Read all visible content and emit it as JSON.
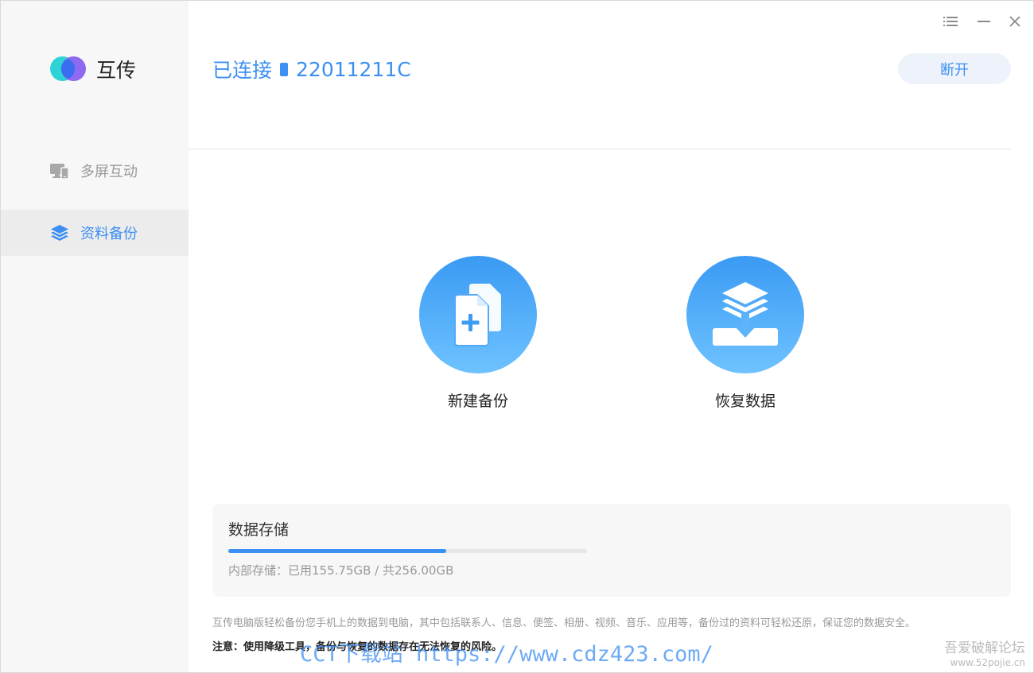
{
  "app": {
    "name": "互传"
  },
  "window_controls": {
    "menu_icon": "list-menu-icon",
    "minimize_icon": "minimize-icon",
    "close_icon": "close-icon"
  },
  "sidebar": {
    "items": [
      {
        "label": "多屏互动",
        "icon": "monitor-phone-icon",
        "active": false
      },
      {
        "label": "资料备份",
        "icon": "layers-icon",
        "active": true
      }
    ]
  },
  "header": {
    "status": "已连接",
    "device_icon": "phone-icon",
    "device_name": "22011211C",
    "disconnect_label": "断开"
  },
  "actions": [
    {
      "label": "新建备份",
      "icon": "new-backup-icon"
    },
    {
      "label": "恢复数据",
      "icon": "restore-data-icon"
    }
  ],
  "storage": {
    "title": "数据存储",
    "info": "内部存储：已用155.75GB / 共256.00GB",
    "used_fraction": 0.608
  },
  "description": "互传电脑版轻松备份您手机上的数据到电脑，其中包括联系人、信息、便签、相册、视频、音乐、应用等，备份过的资料可轻松还原，保证您的数据安全。",
  "note": "注意：使用降级工具，备份与恢复的数据存在无法恢复的风险。",
  "watermark": {
    "main": "CCT下载站 https://www.cdz423.com/",
    "right_line1": "吾爱破解论坛",
    "right_line2": "www.52pojie.cn"
  },
  "colors": {
    "accent": "#3d8ff2",
    "sidebar_bg": "#f7f7f7",
    "sidebar_active_bg": "#ececec"
  }
}
